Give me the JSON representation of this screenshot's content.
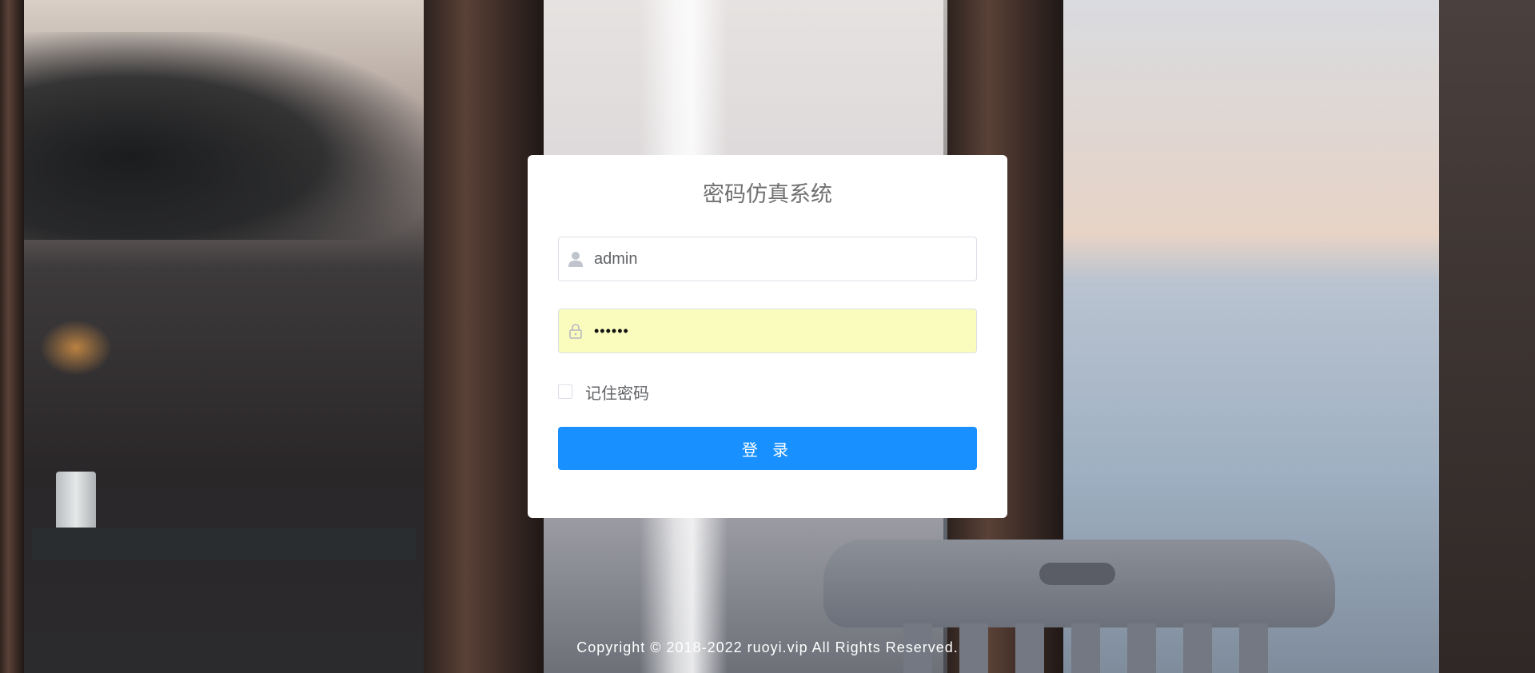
{
  "login": {
    "title": "密码仿真系统",
    "username": {
      "value": "admin",
      "icon": "user-icon"
    },
    "password": {
      "value": "••••••",
      "icon": "lock-icon"
    },
    "remember_label": "记住密码",
    "remember_checked": false,
    "submit_label": "登 录"
  },
  "footer": {
    "copyright": "Copyright © 2018-2022 ruoyi.vip All Rights Reserved."
  },
  "colors": {
    "primary": "#1890ff",
    "autofill_bg": "#fafcbe",
    "title_text": "#707070"
  }
}
